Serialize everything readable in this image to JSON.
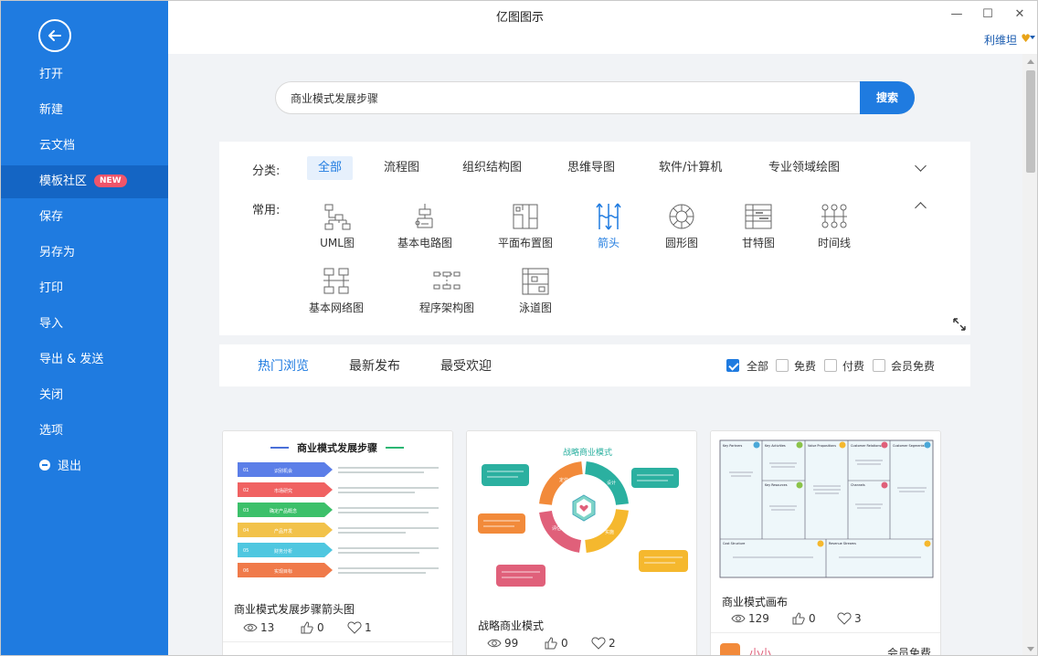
{
  "window": {
    "title": "亿图图示",
    "user_name": "利维坦"
  },
  "sidebar": {
    "items": [
      {
        "label": "打开"
      },
      {
        "label": "新建"
      },
      {
        "label": "云文档"
      },
      {
        "label": "模板社区",
        "badge": "NEW"
      },
      {
        "label": "保存"
      },
      {
        "label": "另存为"
      },
      {
        "label": "打印"
      },
      {
        "label": "导入"
      },
      {
        "label": "导出 & 发送"
      },
      {
        "label": "关闭"
      },
      {
        "label": "选项"
      },
      {
        "label": "退出"
      }
    ]
  },
  "search": {
    "value": "商业模式发展步骤",
    "button": "搜索"
  },
  "categories": {
    "label": "分类:",
    "tabs": [
      "全部",
      "流程图",
      "组织结构图",
      "思维导图",
      "软件/计算机",
      "专业领域绘图"
    ],
    "common_label": "常用:",
    "types": [
      "UML图",
      "基本电路图",
      "平面布置图",
      "箭头",
      "圆形图",
      "甘特图",
      "时间线",
      "基本网络图",
      "程序架构图",
      "泳道图"
    ]
  },
  "filter": {
    "tabs": [
      "热门浏览",
      "最新发布",
      "最受欢迎"
    ],
    "checks": [
      {
        "label": "全部",
        "checked": true
      },
      {
        "label": "免费",
        "checked": false
      },
      {
        "label": "付费",
        "checked": false
      },
      {
        "label": "会员免费",
        "checked": false
      }
    ]
  },
  "cards": [
    {
      "title": "商业模式发展步骤箭头图",
      "views": "13",
      "likes": "0",
      "favs": "1",
      "thumb": {
        "heading": "商业模式发展步骤",
        "steps": [
          {
            "num": "01",
            "label": "识别机会"
          },
          {
            "num": "02",
            "label": "市场研究"
          },
          {
            "num": "03",
            "label": "确定产品概念"
          },
          {
            "num": "04",
            "label": "产品开发"
          },
          {
            "num": "05",
            "label": "财务分析"
          },
          {
            "num": "06",
            "label": "实现目标"
          }
        ]
      }
    },
    {
      "title": "战略商业模式",
      "views": "99",
      "likes": "0",
      "favs": "2",
      "thumb": {
        "heading": "战略商业模式",
        "ring_labels": [
          "定位",
          "设计",
          "实施",
          "评估"
        ]
      }
    },
    {
      "title": "商业模式画布",
      "views": "129",
      "likes": "0",
      "favs": "3",
      "author": "小小",
      "price_tag": "会员免费",
      "thumb": {
        "cells": [
          "Key Partners",
          "Key Activities",
          "Value Propositions",
          "Customer Relationships",
          "Customer Segments",
          "Key Resources",
          "Channels",
          "Cost Structure",
          "Revenue Streams"
        ]
      }
    }
  ],
  "colors": {
    "accent": "#1f7be0",
    "sidebar": "#1f7be0",
    "badge": "#f0556a"
  }
}
